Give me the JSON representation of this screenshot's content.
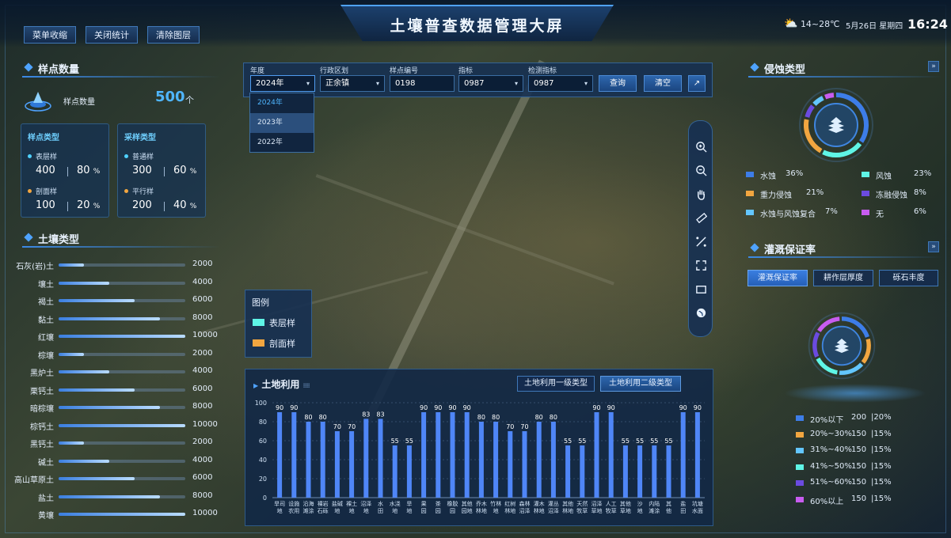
{
  "header": {
    "title": "土壤普查数据管理大屏",
    "buttons": [
      "菜单收缩",
      "关闭统计",
      "清除图层"
    ],
    "weather": "14~28℃",
    "date": "5月26日 星期四",
    "time": "16:24"
  },
  "sample_count": {
    "title": "样点数量",
    "label": "样点数量",
    "value": "500",
    "unit": "个",
    "point_type": {
      "title": "样点类型",
      "items": [
        {
          "label": "表层样",
          "count": "400",
          "pct": "80",
          "color": "#4fd1ff"
        },
        {
          "label": "剖面样",
          "count": "100",
          "pct": "20",
          "color": "#f2a640"
        }
      ]
    },
    "sampling_type": {
      "title": "采样类型",
      "items": [
        {
          "label": "普通样",
          "count": "300",
          "pct": "60",
          "color": "#4fd1ff"
        },
        {
          "label": "平行样",
          "count": "200",
          "pct": "40",
          "color": "#f2a640"
        }
      ]
    },
    "pct_unit": "%"
  },
  "soil_type": {
    "title": "土壤类型",
    "max": 10000,
    "items": [
      {
        "name": "石灰(岩)土",
        "value": 2000
      },
      {
        "name": "壤土",
        "value": 4000
      },
      {
        "name": "褐土",
        "value": 6000
      },
      {
        "name": "黏土",
        "value": 8000
      },
      {
        "name": "红壤",
        "value": 10000
      },
      {
        "name": "棕壤",
        "value": 2000
      },
      {
        "name": "黑炉土",
        "value": 4000
      },
      {
        "name": "栗钙土",
        "value": 6000
      },
      {
        "name": "暗棕壤",
        "value": 8000
      },
      {
        "name": "棕钙土",
        "value": 10000
      },
      {
        "name": "黑钙土",
        "value": 2000
      },
      {
        "name": "碱土",
        "value": 4000
      },
      {
        "name": "高山草原土",
        "value": 6000
      },
      {
        "name": "盐土",
        "value": 8000
      },
      {
        "name": "黄壤",
        "value": 10000
      }
    ]
  },
  "filter": {
    "fields": [
      {
        "label": "年度",
        "value": "2024年",
        "dropdown": true
      },
      {
        "label": "行政区划",
        "value": "正余镇",
        "dropdown": true
      },
      {
        "label": "样点编号",
        "value": "0198",
        "dropdown": false
      },
      {
        "label": "指标",
        "value": "0987",
        "dropdown": true
      },
      {
        "label": "检测指标",
        "value": "0987",
        "dropdown": true
      }
    ],
    "query_label": "查询",
    "clear_label": "清空",
    "year_options": [
      "2024年",
      "2023年",
      "2022年"
    ],
    "caret": "▾",
    "export_icon": "↗"
  },
  "legend": {
    "title": "图例",
    "items": [
      {
        "label": "表层样",
        "color": "#5ff5e6"
      },
      {
        "label": "剖面样",
        "color": "#f2a640"
      }
    ]
  },
  "tools": [
    "zoom-in-icon",
    "zoom-out-icon",
    "hand-icon",
    "ruler-icon",
    "measure-icon",
    "fullscreen-icon",
    "rectangle-icon",
    "globe-icon"
  ],
  "land_use": {
    "title": "土地利用",
    "tabs": [
      "土地利用一级类型",
      "土地利用二级类型"
    ],
    "active_tab": 1
  },
  "erosion": {
    "title": "侵蚀类型",
    "expand": "»",
    "items": [
      {
        "label": "水蚀",
        "pct": "36%",
        "color": "#3d7de8"
      },
      {
        "label": "风蚀",
        "pct": "23%",
        "color": "#5ff5e6"
      },
      {
        "label": "重力侵蚀",
        "pct": "21%",
        "color": "#f2a640"
      },
      {
        "label": "冻融侵蚀",
        "pct": "8%",
        "color": "#6b4be0"
      },
      {
        "label": "水蚀与风蚀复合",
        "pct": "7%",
        "color": "#63c6ff"
      },
      {
        "label": "无",
        "pct": "6%",
        "color": "#c85cf0"
      }
    ]
  },
  "irrigation": {
    "title": "灌溉保证率",
    "expand": "»",
    "tabs": [
      "灌溉保证率",
      "耕作层厚度",
      "砾石丰度"
    ],
    "active_tab": 0,
    "items": [
      {
        "label": "20%以下",
        "count": "200",
        "pct": "|20%",
        "color": "#3d7de8"
      },
      {
        "label": "20%~30%",
        "count": "150",
        "pct": "|15%",
        "color": "#f2a640"
      },
      {
        "label": "31%~40%",
        "count": "150",
        "pct": "|15%",
        "color": "#63c6ff"
      },
      {
        "label": "41%~50%",
        "count": "150",
        "pct": "|15%",
        "color": "#5ff5e6"
      },
      {
        "label": "51%~60%",
        "count": "150",
        "pct": "|15%",
        "color": "#6b4be0"
      },
      {
        "label": "60%以上",
        "count": "150",
        "pct": "|15%",
        "color": "#c85cf0"
      }
    ]
  },
  "chart_data": {
    "type": "bar",
    "ylim": [
      0,
      100
    ],
    "yticks": [
      0,
      20,
      40,
      60,
      80,
      100
    ],
    "categories": [
      "旱司地",
      "设施农用",
      "沿海滩涂",
      "裸岩石砾",
      "盐碱地",
      "裸土地",
      "沼泽地",
      "水田",
      "水浇地",
      "旱地",
      "果园",
      "茶园",
      "橡胶园",
      "其他园地",
      "乔木林地",
      "竹林地",
      "红树林地",
      "森林沼泽",
      "灌木林地",
      "灌丛沼泽",
      "其他林地",
      "天然牧草",
      "沼泽草地",
      "人工牧草",
      "其他草地",
      "沙地",
      "内陆滩涂",
      "其他",
      "盐田",
      "坑塘水面"
    ],
    "values": [
      90,
      90,
      80,
      80,
      70,
      70,
      83,
      83,
      55,
      55,
      90,
      90,
      90,
      90,
      80,
      80,
      70,
      70,
      80,
      80,
      55,
      55,
      90,
      90,
      55,
      55,
      55,
      55,
      90,
      90
    ],
    "labels": [
      "90",
      "90",
      "80",
      "80",
      "70",
      "70",
      "83",
      "83",
      "55",
      "55",
      "90",
      "90",
      "90",
      "90",
      "80",
      "80",
      "70",
      "70",
      "80",
      "80",
      "55",
      "55",
      "90",
      "90",
      "55",
      "55",
      "55",
      "55",
      "90",
      "90"
    ],
    "color": "#4f86f7"
  }
}
